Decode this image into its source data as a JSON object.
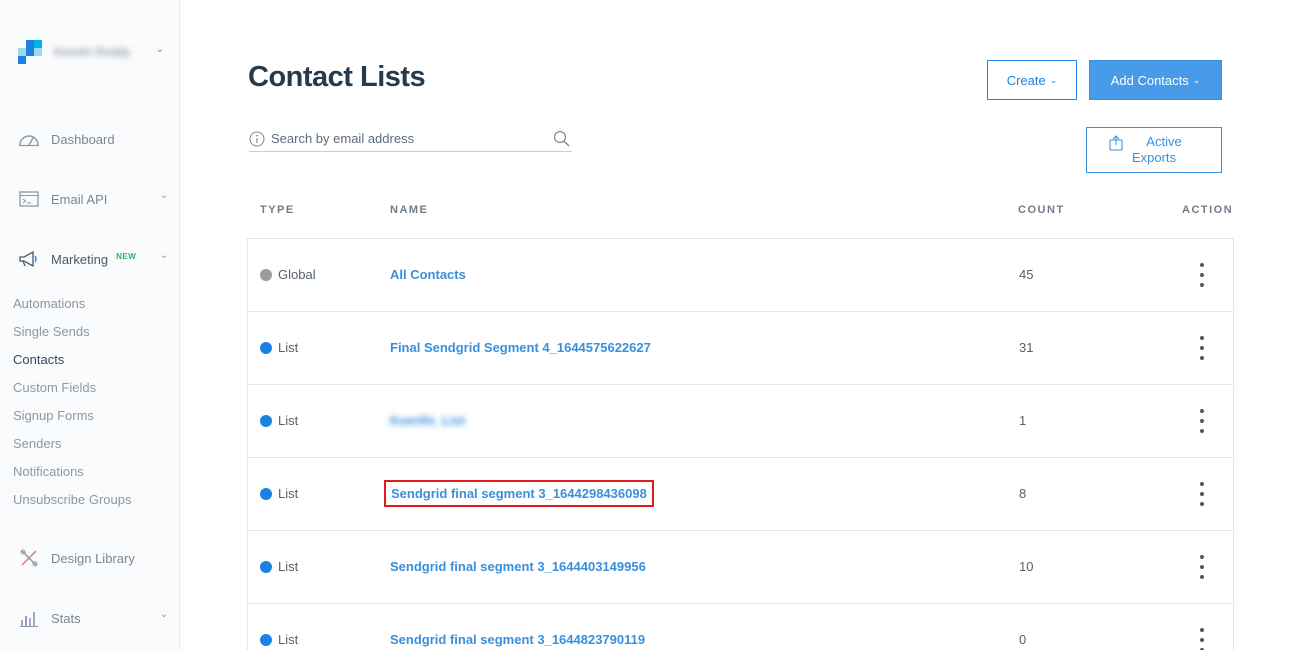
{
  "account": {
    "name": "Keerthi Reddy"
  },
  "sidebar": {
    "items": [
      {
        "label": "Dashboard",
        "icon": "gauge-icon"
      },
      {
        "label": "Email API",
        "icon": "terminal-icon"
      },
      {
        "label": "Marketing",
        "icon": "megaphone-icon",
        "badge": "NEW"
      },
      {
        "label": "Design Library",
        "icon": "design-tools-icon"
      },
      {
        "label": "Stats",
        "icon": "bar-chart-icon"
      }
    ],
    "marketing_subitems": [
      "Automations",
      "Single Sends",
      "Contacts",
      "Custom Fields",
      "Signup Forms",
      "Senders",
      "Notifications",
      "Unsubscribe Groups"
    ],
    "active_subitem": "Contacts"
  },
  "header": {
    "title": "Contact Lists",
    "create_label": "Create",
    "add_contacts_label": "Add Contacts",
    "active_exports_line1": "Active",
    "active_exports_line2": "Exports"
  },
  "search": {
    "placeholder": "Search by email address"
  },
  "table": {
    "columns": [
      "TYPE",
      "NAME",
      "COUNT",
      "ACTION"
    ],
    "rows": [
      {
        "type": "Global",
        "name": "All Contacts",
        "count": "45"
      },
      {
        "type": "List",
        "name": "Final Sendgrid Segment 4_1644575622627",
        "count": "31"
      },
      {
        "type": "List",
        "name": "Keerthi_List",
        "count": "1"
      },
      {
        "type": "List",
        "name": "Sendgrid final segment 3_1644298436098",
        "count": "8"
      },
      {
        "type": "List",
        "name": "Sendgrid final segment 3_1644403149956",
        "count": "10"
      },
      {
        "type": "List",
        "name": "Sendgrid final segment 3_1644823790119",
        "count": "0"
      }
    ]
  },
  "colors": {
    "accent": "#1a82e2",
    "link": "#3a8fdc",
    "global_dot": "#9b9b9b",
    "list_dot": "#1a82e2",
    "highlight_box": "#e01b1b",
    "new_badge": "#2db36b"
  }
}
